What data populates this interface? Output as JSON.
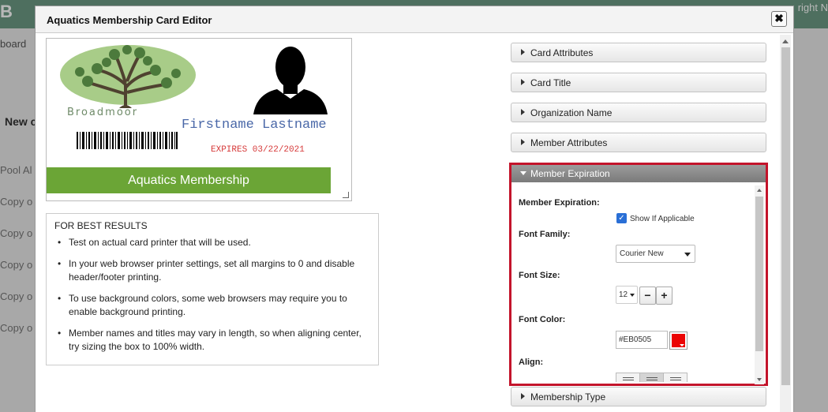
{
  "background": {
    "brand": "B",
    "user_text": "right N",
    "breadcrumb": "board",
    "new_label": "New c",
    "rows": [
      "Pool Al",
      "Copy o",
      "Copy o",
      "Copy o",
      "Copy o",
      "Copy o"
    ]
  },
  "modal": {
    "title": "Aquatics Membership Card Editor",
    "close_label": "✖"
  },
  "card": {
    "logo_text": "Broadmoor",
    "name": "Firstname Lastname",
    "expires": "EXPIRES 03/22/2021",
    "band_text": "Aquatics Membership",
    "band_color": "#6BA536",
    "name_color": "#4A68A8",
    "expires_color": "#D63A3A"
  },
  "tips": {
    "title": "FOR BEST RESULTS",
    "items": [
      "Test on actual card printer that will be used.",
      "In your web browser printer settings, set all margins to 0 and disable header/footer printing.",
      "To use background colors, some web browsers may require you to enable background printing.",
      "Member names and titles may vary in length, so when aligning center, try sizing the box to 100% width."
    ]
  },
  "accordion": {
    "sections": [
      "Card Attributes",
      "Card Title",
      "Organization Name",
      "Member Attributes"
    ],
    "open_section": "Member Expiration",
    "bottom_section": "Membership Type",
    "highlight_color": "#C3142B"
  },
  "expiration": {
    "member_expiration_label": "Member Expiration:",
    "show_label": "Show If Applicable",
    "show_checked": true,
    "font_family_label": "Font Family:",
    "font_family_value": "Courier New",
    "font_size_label": "Font Size:",
    "font_size_value": "12",
    "decrease": "−",
    "increase": "+",
    "font_color_label": "Font Color:",
    "font_color_value": "#EB0505",
    "align_label": "Align:",
    "align_selected": "center"
  }
}
